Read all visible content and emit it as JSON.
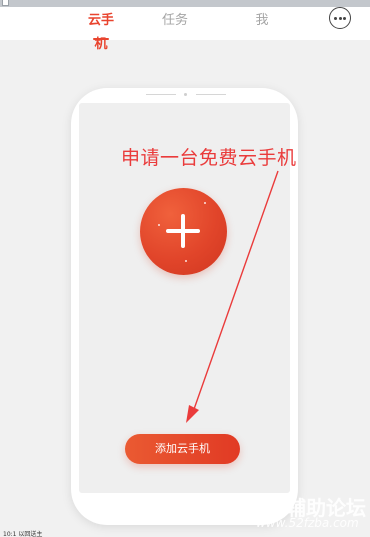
{
  "header": {
    "tabs": [
      {
        "label": "云手机",
        "active": true
      },
      {
        "label": "任务",
        "active": false
      },
      {
        "label": "我",
        "active": false
      }
    ]
  },
  "icons": {
    "message": "chat-bubble-icon",
    "add": "plus-icon"
  },
  "annotation": {
    "text": "申请一台免费云手机",
    "color": "#ea3b3b"
  },
  "main": {
    "add_button_label": "添加云手机"
  },
  "watermark": {
    "site_name": "辅助论坛",
    "url": "www.52fzba.com"
  },
  "status_bar": {
    "text": "10:1 以回送主"
  },
  "colors": {
    "accent": "#e9442e",
    "inactive_tab": "#a5a5a5",
    "background": "#f1f1f1"
  }
}
